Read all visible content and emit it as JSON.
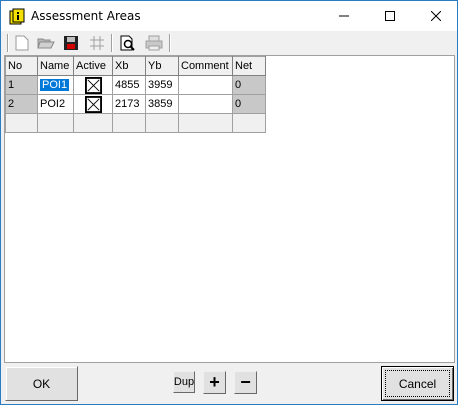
{
  "window": {
    "title": "Assessment Areas",
    "minimize_glyph": "—",
    "maximize_glyph": "☐",
    "close_glyph": "✕"
  },
  "toolbar": {
    "icons": [
      "new-icon",
      "open-icon",
      "save-icon",
      "grid-icon",
      "preview-icon",
      "print-icon"
    ]
  },
  "grid": {
    "columns": [
      "No",
      "Name",
      "Active",
      "Xb",
      "Yb",
      "Comment",
      "Net"
    ],
    "rows": [
      {
        "no": "1",
        "name": "POI1",
        "active": true,
        "xb": "4855",
        "yb": "3959",
        "comment": "",
        "net": "0"
      },
      {
        "no": "2",
        "name": "POI2",
        "active": true,
        "xb": "2173",
        "yb": "3859",
        "comment": "",
        "net": "0"
      }
    ]
  },
  "buttons": {
    "ok": "OK",
    "dup": "Dup",
    "plus": "+",
    "minus": "−",
    "cancel": "Cancel"
  },
  "colors": {
    "selection": "#0078d7",
    "window_border": "#2b7bc4"
  }
}
